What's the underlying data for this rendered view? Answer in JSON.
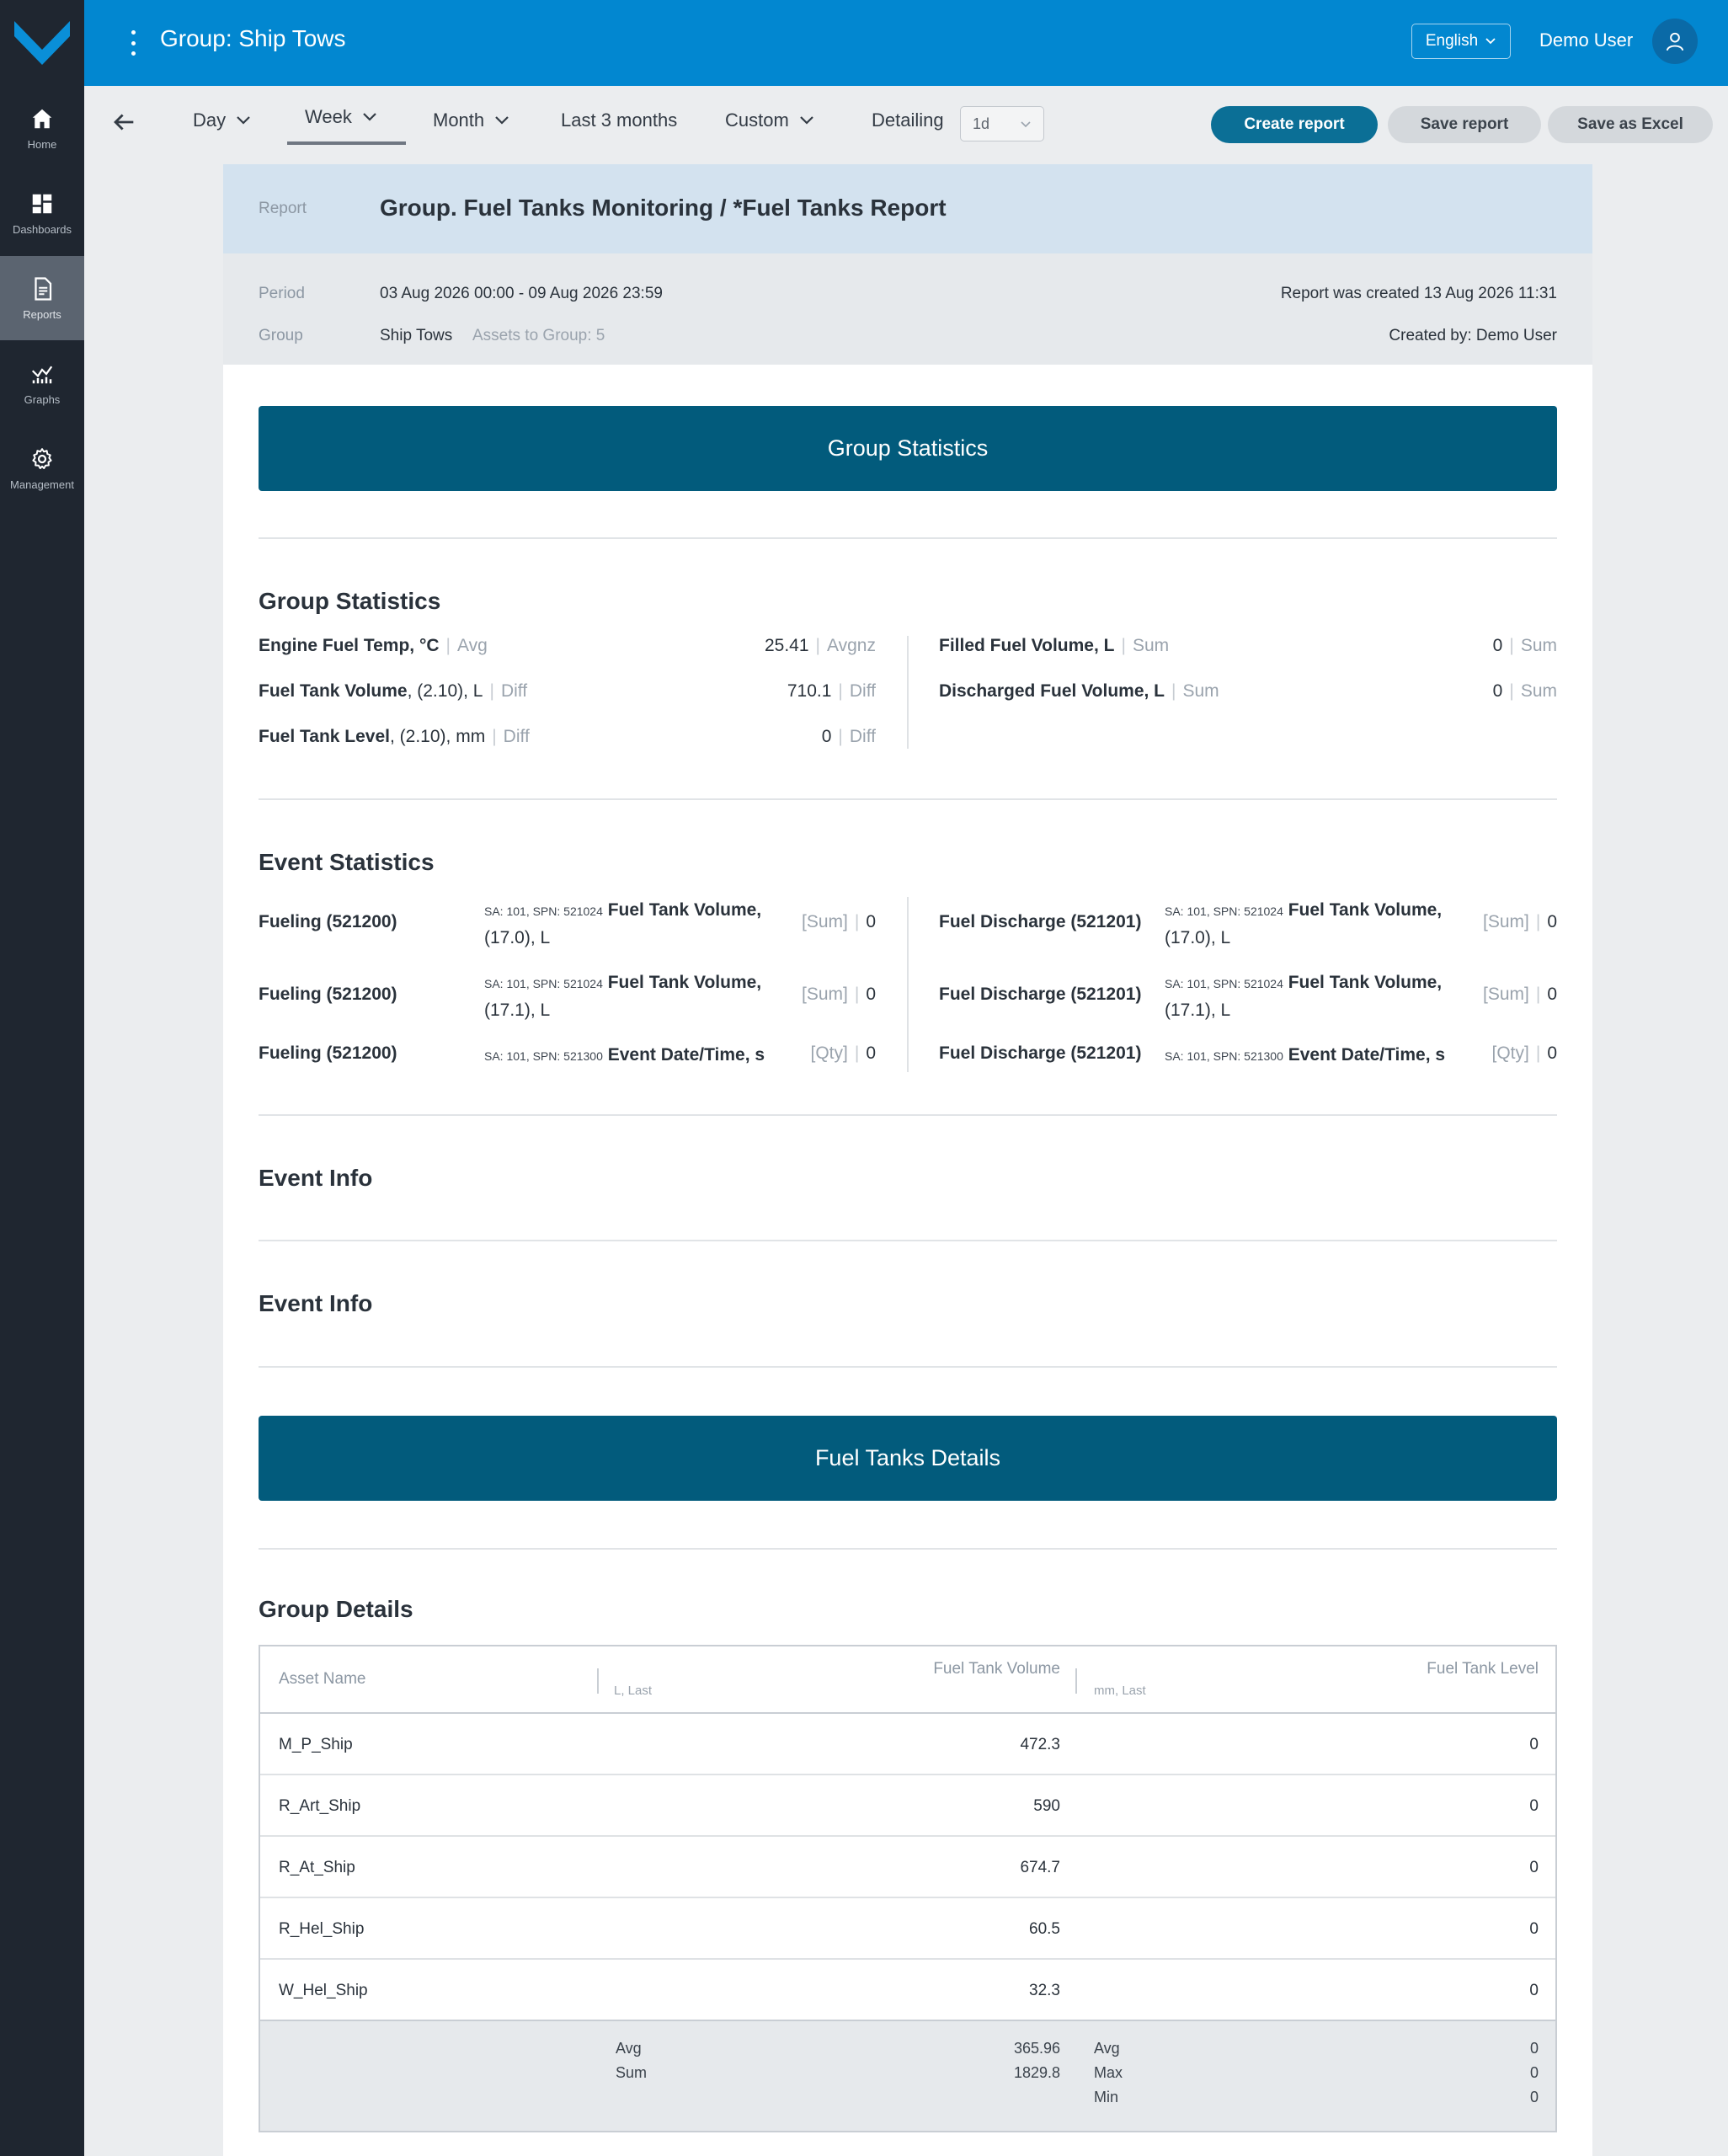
{
  "app": {
    "group_title": "Group: Ship Tows",
    "language": "English",
    "user_name": "Demo User"
  },
  "sidebar": {
    "items": [
      {
        "label": "Home",
        "icon": "home-icon"
      },
      {
        "label": "Dashboards",
        "icon": "dashboards-icon"
      },
      {
        "label": "Reports",
        "icon": "reports-icon",
        "active": true
      },
      {
        "label": "Graphs",
        "icon": "graphs-icon"
      },
      {
        "label": "Management",
        "icon": "gear-icon"
      }
    ]
  },
  "toolbar": {
    "day": "Day",
    "week": "Week",
    "month": "Month",
    "last3": "Last 3 months",
    "custom": "Custom",
    "detailing_label": "Detailing",
    "detailing_value": "1d",
    "create_report": "Create report",
    "save_report": "Save report",
    "save_excel": "Save as Excel"
  },
  "report": {
    "report_label": "Report",
    "title": "Group. Fuel Tanks Monitoring / *Fuel Tanks Report",
    "period_label": "Period",
    "period_value": "03 Aug 2026 00:00 - 09 Aug 2026 23:59",
    "group_label": "Group",
    "group_value": "Ship Tows",
    "assets_count": "Assets to Group: 5",
    "created_at": "Report was created 13 Aug 2026 11:31",
    "created_by": "Created by: Demo User"
  },
  "group_statistics": {
    "banner": "Group Statistics",
    "title": "Group Statistics",
    "left": [
      {
        "name": "Engine Fuel Temp, °C",
        "tag": "Avg",
        "value": "25.41",
        "agg": "Avgnz"
      },
      {
        "name": "Fuel Tank Volume",
        "extra": ", (2.10), L",
        "tag": "Diff",
        "value": "710.1",
        "agg": "Diff"
      },
      {
        "name": "Fuel Tank Level",
        "extra": ", (2.10), mm",
        "tag": "Diff",
        "value": "0",
        "agg": "Diff"
      }
    ],
    "right": [
      {
        "name": "Filled Fuel Volume, L",
        "tag": "Sum",
        "value": "0",
        "agg": "Sum"
      },
      {
        "name": "Discharged Fuel Volume, L",
        "tag": "Sum",
        "value": "0",
        "agg": "Sum"
      }
    ]
  },
  "event_statistics": {
    "title": "Event Statistics",
    "left": [
      {
        "event": "Fueling (521200)",
        "sa": "SA: 101, SPN: 521024",
        "param": "Fuel Tank Volume,",
        "param2": "(17.0), L",
        "tag": "[Sum]",
        "value": "0"
      },
      {
        "event": "Fueling (521200)",
        "sa": "SA: 101, SPN: 521024",
        "param": "Fuel Tank Volume,",
        "param2": "(17.1), L",
        "tag": "[Sum]",
        "value": "0"
      },
      {
        "event": "Fueling (521200)",
        "sa": "SA: 101, SPN: 521300",
        "param": "Event Date/Time, s",
        "param2": "",
        "tag": "[Qty]",
        "value": "0"
      }
    ],
    "right": [
      {
        "event": "Fuel Discharge (521201)",
        "sa": "SA: 101, SPN: 521024",
        "param": "Fuel Tank Volume,",
        "param2": "(17.0), L",
        "tag": "[Sum]",
        "value": "0"
      },
      {
        "event": "Fuel Discharge (521201)",
        "sa": "SA: 101, SPN: 521024",
        "param": "Fuel Tank Volume,",
        "param2": "(17.1), L",
        "tag": "[Sum]",
        "value": "0"
      },
      {
        "event": "Fuel Discharge (521201)",
        "sa": "SA: 101, SPN: 521300",
        "param": "Event Date/Time, s",
        "param2": "",
        "tag": "[Qty]",
        "value": "0"
      }
    ]
  },
  "event_info_1": "Event Info",
  "event_info_2": "Event Info",
  "fuel_tanks": {
    "banner": "Fuel Tanks Details",
    "title": "Group Details",
    "columns": {
      "asset": "Asset Name",
      "col2_sub": "L, Last",
      "col2": "Fuel Tank Volume",
      "col3_sub": "mm, Last",
      "col3": "Fuel Tank Level"
    },
    "rows": [
      {
        "name": "M_P_Ship",
        "volume": "472.3",
        "level": "0"
      },
      {
        "name": "R_Art_Ship",
        "volume": "590",
        "level": "0"
      },
      {
        "name": "R_At_Ship",
        "volume": "674.7",
        "level": "0"
      },
      {
        "name": "R_Hel_Ship",
        "volume": "60.5",
        "level": "0"
      },
      {
        "name": "W_Hel_Ship",
        "volume": "32.3",
        "level": "0"
      }
    ],
    "footer": {
      "vol_labels": [
        "Avg",
        "Sum"
      ],
      "vol_values": [
        "365.96",
        "1829.8"
      ],
      "lvl_labels": [
        "Avg",
        "Max",
        "Min"
      ],
      "lvl_values": [
        "0",
        "0",
        "0"
      ]
    }
  },
  "colors": {
    "topbar": "#0287d0",
    "sidebar": "#1f2630",
    "banner": "#025b7c",
    "primary_button": "#0b6f96"
  }
}
